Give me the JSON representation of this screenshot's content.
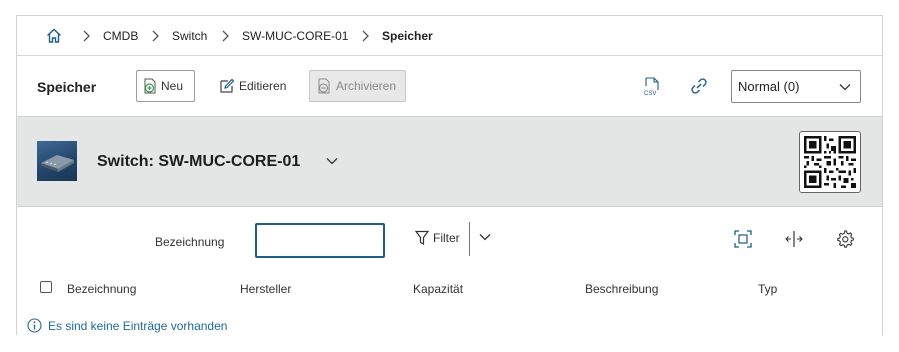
{
  "breadcrumb": {
    "items": [
      "CMDB",
      "Switch",
      "SW-MUC-CORE-01"
    ],
    "current": "Speicher"
  },
  "toolbar": {
    "title": "Speicher",
    "new_label": "Neu",
    "edit_label": "Editieren",
    "archive_label": "Archivieren",
    "view_select": "Normal (0)"
  },
  "object": {
    "title": "Switch: SW-MUC-CORE-01"
  },
  "filter": {
    "label": "Bezeichnung",
    "value": "",
    "filter_label": "Filter"
  },
  "table": {
    "columns": [
      "Bezeichnung",
      "Hersteller",
      "Kapazität",
      "Beschreibung",
      "Typ"
    ],
    "rows": [],
    "empty_message": "Es sind keine Einträge vorhanden"
  },
  "colors": {
    "accent": "#1b5f83",
    "header_band": "#e4e5e5",
    "info_text": "#1f6a9a",
    "new_icon": "#3a9a4a"
  },
  "icons": [
    "home-icon",
    "chevron-right-icon",
    "plus-circle-icon",
    "edit-icon",
    "archive-icon",
    "csv-icon",
    "link-icon",
    "chevron-down-icon",
    "qr-code-icon",
    "filter-icon",
    "fullscreen-icon",
    "column-resize-icon",
    "gear-icon",
    "info-icon"
  ]
}
